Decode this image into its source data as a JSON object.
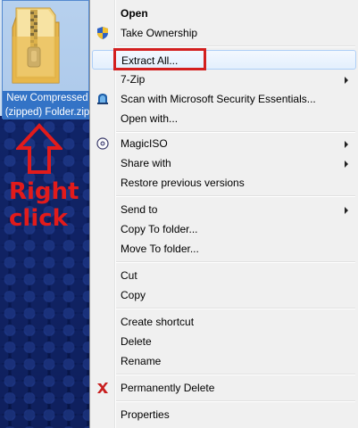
{
  "desktop": {
    "file_label": "New Compressed\n(zipped) Folder.zip",
    "hint_text": "Right\nclick",
    "hint_color": "#e21b1b"
  },
  "menu": {
    "items": {
      "open": "Open",
      "take_ownership": "Take Ownership",
      "extract_all": "Extract All...",
      "seven_zip": "7-Zip",
      "scan": "Scan with Microsoft Security Essentials...",
      "open_with": "Open with...",
      "magiciso": "MagicISO",
      "share_with": "Share with",
      "restore": "Restore previous versions",
      "send_to": "Send to",
      "copy_to": "Copy To folder...",
      "move_to": "Move To folder...",
      "cut": "Cut",
      "copy": "Copy",
      "create_shortcut": "Create shortcut",
      "delete": "Delete",
      "rename": "Rename",
      "permanently_delete": "Permanently Delete",
      "properties": "Properties"
    },
    "highlight_color": "#d31f1f"
  }
}
